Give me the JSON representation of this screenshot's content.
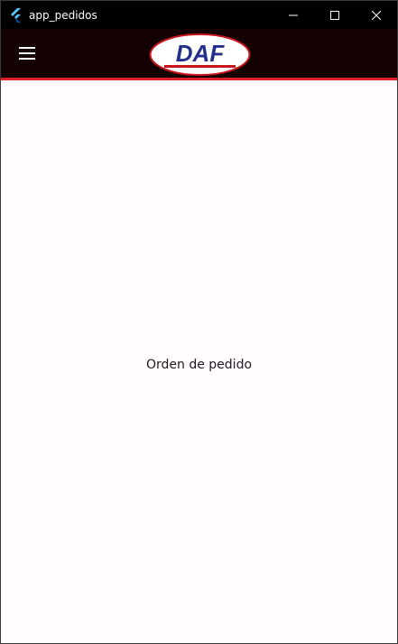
{
  "window": {
    "title": "app_pedidos",
    "app_icon": "flutter-icon",
    "controls": {
      "minimize_icon": "minimize-icon",
      "maximize_icon": "maximize-icon",
      "close_icon": "close-icon"
    }
  },
  "appbar": {
    "menu_icon": "hamburger-menu-icon",
    "logo_text": "DAF",
    "background_color": "#140202",
    "accent_color": "#e02228"
  },
  "main": {
    "text": "Orden de pedido"
  }
}
